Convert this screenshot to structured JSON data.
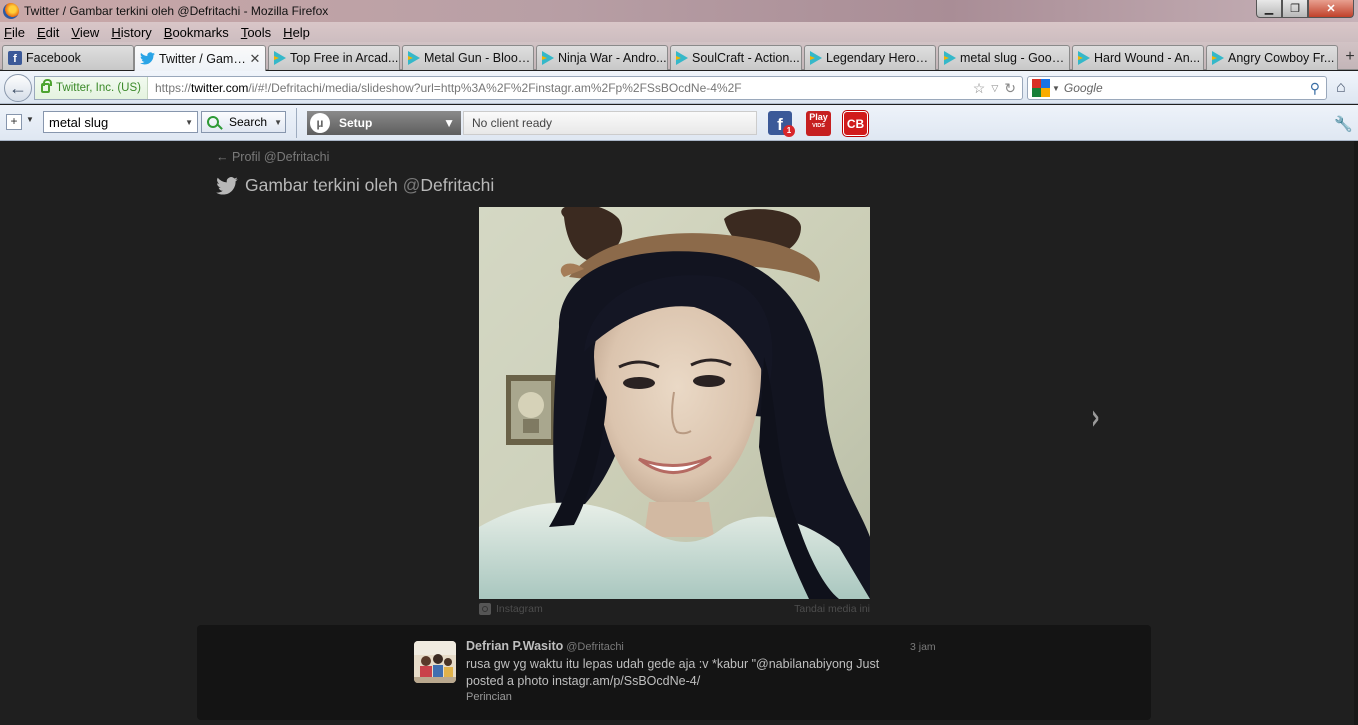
{
  "window": {
    "title": "Twitter / Gambar terkini oleh @Defritachi - Mozilla Firefox",
    "buttons": {
      "minimize": "▁",
      "maximize": "❐",
      "close": "✕"
    }
  },
  "menu": [
    "File",
    "Edit",
    "View",
    "History",
    "Bookmarks",
    "Tools",
    "Help"
  ],
  "tabs": [
    {
      "label": "Facebook",
      "icon": "facebook-icon"
    },
    {
      "label": "Twitter / Gamb...",
      "icon": "twitter-icon",
      "active": true,
      "close": "✕"
    },
    {
      "label": "Top Free in Arcad...",
      "icon": "google-play-icon"
    },
    {
      "label": "Metal Gun - Blood...",
      "icon": "google-play-icon"
    },
    {
      "label": "Ninja War - Andro...",
      "icon": "google-play-icon"
    },
    {
      "label": "SoulCraft - Action...",
      "icon": "google-play-icon"
    },
    {
      "label": "Legendary Heroes...",
      "icon": "google-play-icon"
    },
    {
      "label": "metal slug - Goog...",
      "icon": "google-play-icon"
    },
    {
      "label": "Hard Wound - An...",
      "icon": "google-play-icon"
    },
    {
      "label": "Angry Cowboy Fr...",
      "icon": "google-play-icon"
    }
  ],
  "new_tab": "+",
  "navbar": {
    "back": "←",
    "identity": "Twitter, Inc. (US)",
    "url_prefix": "https://",
    "url_domain": "twitter.com",
    "url_rest": "/i/#!/Defritachi/media/slideshow?url=http%3A%2F%2Finstagr.am%2Fp%2FSsBOcdNe-4%2F",
    "search_placeholder": "Google"
  },
  "toolbar": {
    "plus": "+",
    "search_value": "metal slug",
    "search_button": "Search",
    "utorrent_logo": "µ",
    "utorrent_setup": "Setup",
    "utorrent_status": "No client ready",
    "facebook_badge": "1",
    "play_label": "Play",
    "play_sub": "VIDS",
    "cb_label": "CB"
  },
  "page": {
    "back_link": "← Profil @Defritachi",
    "title_prefix": "Gambar terkini oleh ",
    "title_at": "@",
    "title_user": "Defritachi",
    "photo_source": "Instagram",
    "tag_media": "Tandai media ini",
    "next": "›"
  },
  "tweet": {
    "name": "Defrian P.Wasito",
    "handle": "@Defritachi",
    "time": "3 jam",
    "text": "rusa gw yg waktu itu lepas udah gede aja :v *kabur \"@nabilanabiyong Just posted a photo instagr.am/p/SsBOcdNe-4/",
    "details": "Perincian"
  },
  "colors": {
    "page_bg": "#1f1f1f",
    "tweet_bg": "#141414",
    "identity_green": "#3b8a29",
    "twitter_blue": "#2aa4e6"
  }
}
